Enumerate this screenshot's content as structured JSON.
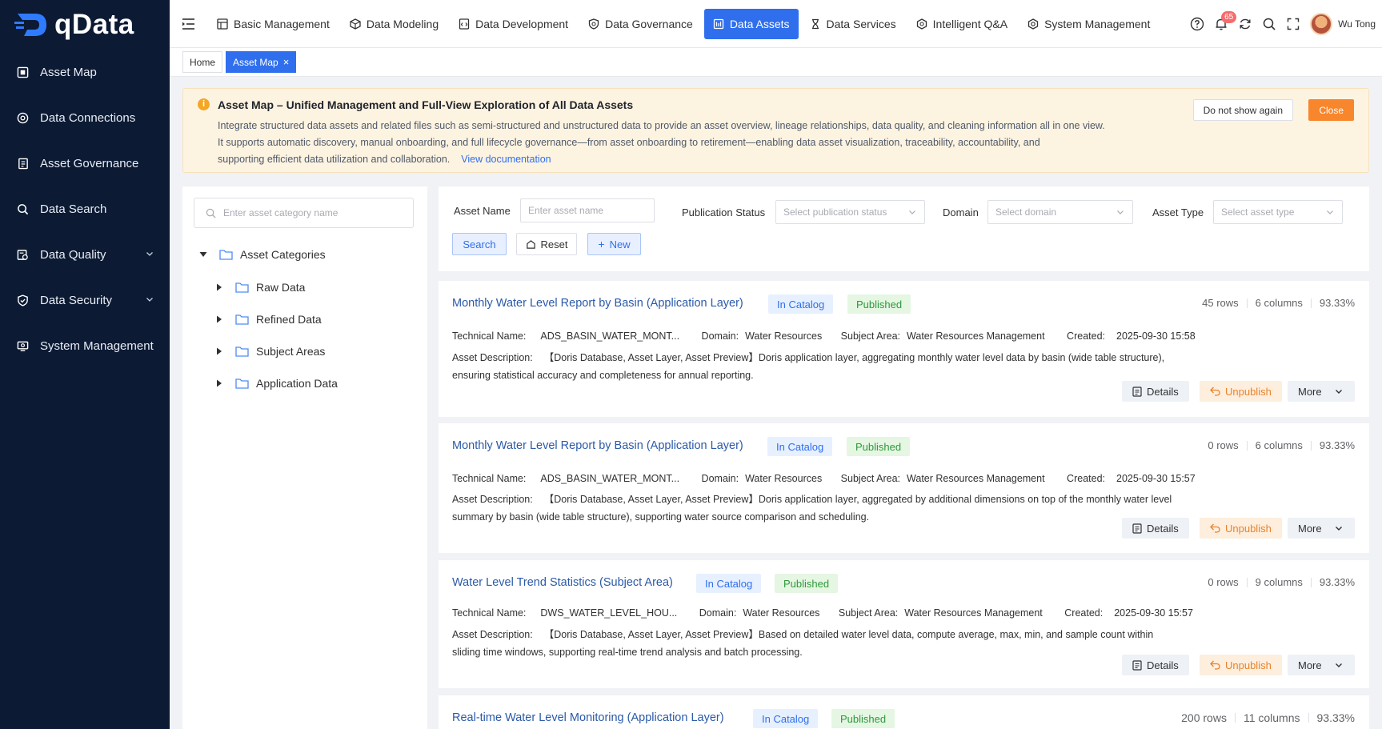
{
  "app": {
    "name": "qData"
  },
  "sidebar": {
    "items": [
      {
        "label": "Asset Map",
        "icon": "map-icon"
      },
      {
        "label": "Data Connections",
        "icon": "connection-icon"
      },
      {
        "label": "Asset Governance",
        "icon": "governance-icon"
      },
      {
        "label": "Data Search",
        "icon": "search-icon"
      },
      {
        "label": "Data Quality",
        "icon": "quality-icon",
        "expandable": true
      },
      {
        "label": "Data Security",
        "icon": "shield-icon",
        "expandable": true
      },
      {
        "label": "System Management",
        "icon": "system-icon"
      }
    ]
  },
  "topnav": {
    "tabs": [
      {
        "label": "Basic Management"
      },
      {
        "label": "Data Modeling"
      },
      {
        "label": "Data Development"
      },
      {
        "label": "Data Governance"
      },
      {
        "label": "Data Assets",
        "active": true
      },
      {
        "label": "Data Services"
      },
      {
        "label": "Intelligent Q&A"
      },
      {
        "label": "System Management"
      }
    ],
    "notification_count": "65",
    "user_name": "Wu Tong"
  },
  "tags": {
    "home": "Home",
    "current": "Asset Map"
  },
  "notice": {
    "title": "Asset Map – Unified Management and Full-View Exploration of All Data Assets",
    "line1": "Integrate structured data assets and related files such as semi-structured and unstructured data to provide an asset overview, lineage relationships, data quality, and cleaning information all in one view.",
    "line2": "It supports automatic discovery, manual onboarding, and full lifecycle governance—from asset onboarding to retirement—enabling data asset visualization, traceability, accountability, and",
    "line3": "supporting efficient data utilization and collaboration.",
    "link": "View documentation",
    "dont_show": "Do not show again",
    "close": "Close"
  },
  "tree": {
    "search_placeholder": "Enter asset category name",
    "root": "Asset Categories",
    "children": [
      "Raw Data",
      "Refined Data",
      "Subject Areas",
      "Application Data"
    ]
  },
  "filters": {
    "asset_name_label": "Asset Name",
    "asset_name_placeholder": "Enter asset name",
    "publication_status_label": "Publication Status",
    "publication_status_placeholder": "Select publication status",
    "domain_label": "Domain",
    "domain_placeholder": "Select domain",
    "asset_type_label": "Asset Type",
    "asset_type_placeholder": "Select asset type",
    "search": "Search",
    "reset": "Reset",
    "new": "New"
  },
  "labels": {
    "technical_name": "Technical Name:",
    "domain": "Domain:",
    "subject_area": "Subject Area:",
    "created": "Created:",
    "asset_description": "Asset Description:",
    "details": "Details",
    "unpublish": "Unpublish",
    "more": "More"
  },
  "assets": [
    {
      "title": "Monthly Water Level Report by Basin (Application Layer)",
      "catalog": "In Catalog",
      "status": "Published",
      "rows": "45 rows",
      "columns": "6 columns",
      "score": "93.33%",
      "technical_name": "ADS_BASIN_WATER_MONT...",
      "domain": "Water Resources",
      "subject_area": "Water Resources Management",
      "created": "2025-09-30 15:58",
      "desc1": "【Doris Database, Asset Layer, Asset Preview】Doris application layer, aggregating monthly water level data by basin (wide table structure),",
      "desc2": "ensuring statistical accuracy and completeness for annual reporting."
    },
    {
      "title": "Monthly Water Level Report by Basin (Application Layer)",
      "catalog": "In Catalog",
      "status": "Published",
      "rows": "0 rows",
      "columns": "6 columns",
      "score": "93.33%",
      "technical_name": "ADS_BASIN_WATER_MONT...",
      "domain": "Water Resources",
      "subject_area": "Water Resources Management",
      "created": "2025-09-30 15:57",
      "desc1": "【Doris Database, Asset Layer, Asset Preview】Doris application layer, aggregated by additional dimensions on top of the monthly water level",
      "desc2": "summary by basin (wide table structure), supporting water source comparison and scheduling."
    },
    {
      "title": "Water Level Trend Statistics (Subject Area)",
      "catalog": "In Catalog",
      "status": "Published",
      "rows": "0 rows",
      "columns": "9 columns",
      "score": "93.33%",
      "technical_name": "DWS_WATER_LEVEL_HOU...",
      "domain": "Water Resources",
      "subject_area": "Water Resources Management",
      "created": "2025-09-30 15:57",
      "desc1": "【Doris Database, Asset Layer, Asset Preview】Based on detailed water level data, compute average, max, min, and sample count within",
      "desc2": "sliding time windows, supporting real-time trend analysis and batch processing."
    },
    {
      "title": "Real-time Water Level Monitoring (Application Layer)",
      "catalog": "In Catalog",
      "status": "Published",
      "rows": "200 rows",
      "columns": "11 columns",
      "score": "93.33%"
    }
  ]
}
